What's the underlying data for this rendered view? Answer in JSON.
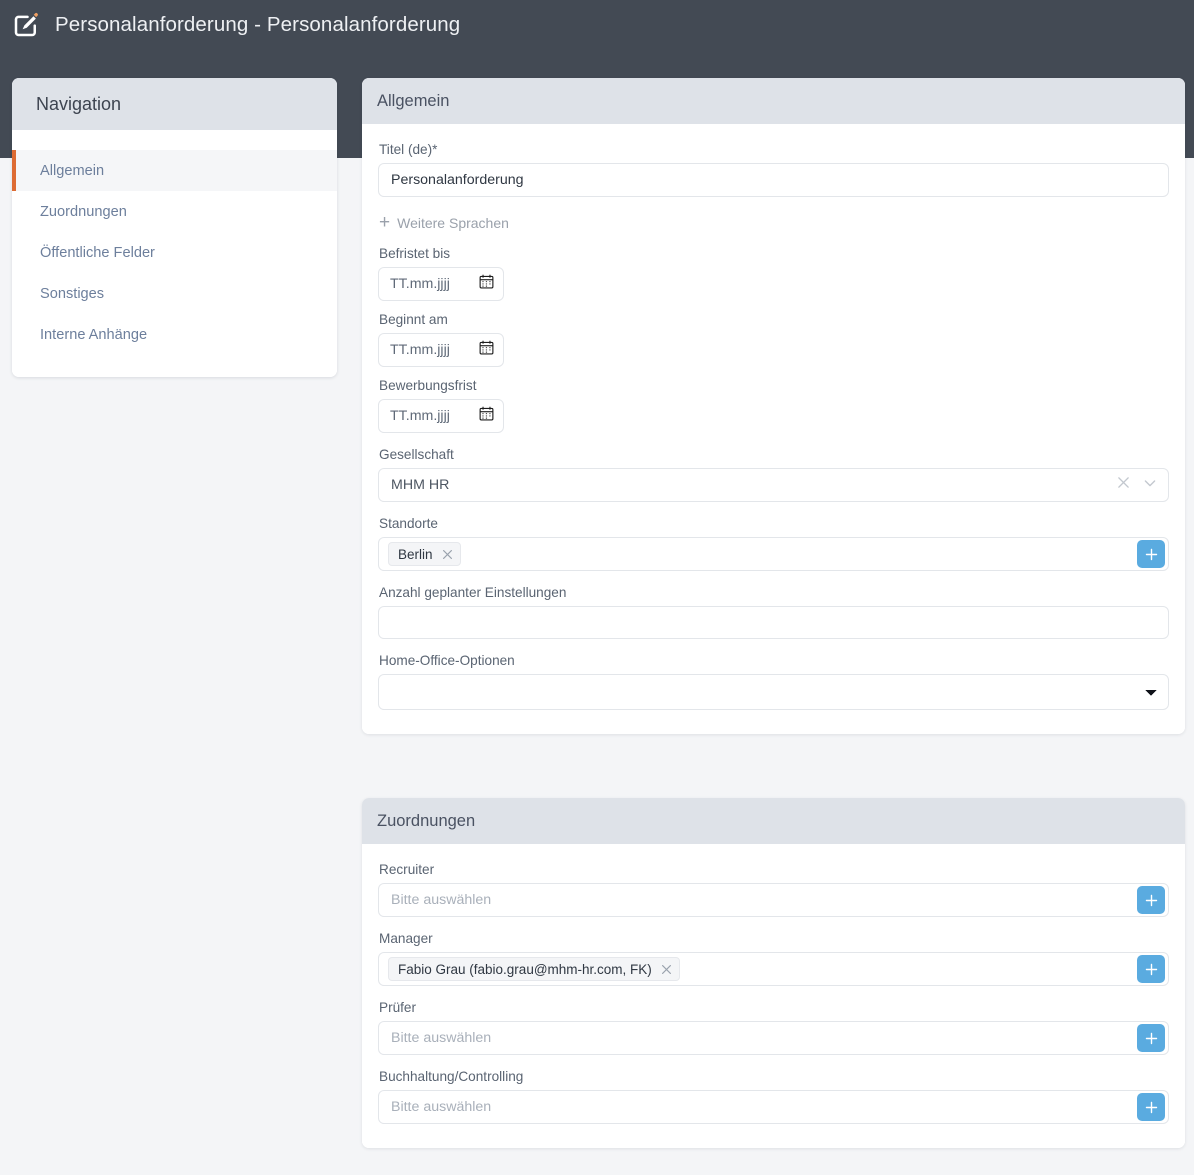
{
  "window": {
    "title": "Personalanforderung - Personalanforderung",
    "icon": "edit-pencil-square-icon"
  },
  "sidebar": {
    "heading": "Navigation",
    "items": [
      {
        "label": "Allgemein",
        "active": true
      },
      {
        "label": "Zuordnungen",
        "active": false
      },
      {
        "label": "Öffentliche Felder",
        "active": false
      },
      {
        "label": "Sonstiges",
        "active": false
      },
      {
        "label": "Interne Anhänge",
        "active": false
      }
    ]
  },
  "allgemein": {
    "heading": "Allgemein",
    "titel": {
      "label": "Titel (de)*",
      "value": "Personalanforderung"
    },
    "weitere_sprachen": {
      "label": "Weitere Sprachen",
      "icon": "plus-icon"
    },
    "befristet_bis": {
      "label": "Befristet bis",
      "placeholder": "TT.mm.jjjj",
      "icon": "calendar-icon"
    },
    "beginnt_am": {
      "label": "Beginnt am",
      "placeholder": "TT.mm.jjjj",
      "icon": "calendar-icon"
    },
    "bewerbungsfrist": {
      "label": "Bewerbungsfrist",
      "placeholder": "TT.mm.jjjj",
      "icon": "calendar-icon"
    },
    "gesellschaft": {
      "label": "Gesellschaft",
      "value": "MHM HR",
      "clear_icon": "close-icon",
      "chevron_icon": "chevron-down-icon"
    },
    "standorte": {
      "label": "Standorte",
      "tags": [
        "Berlin"
      ],
      "add_icon": "plus-icon"
    },
    "anzahl_einstellungen": {
      "label": "Anzahl geplanter Einstellungen",
      "value": ""
    },
    "home_office": {
      "label": "Home-Office-Optionen",
      "value": "",
      "options": [
        ""
      ]
    }
  },
  "zuordnungen": {
    "heading": "Zuordnungen",
    "recruiter": {
      "label": "Recruiter",
      "placeholder": "Bitte auswählen",
      "tags": [],
      "add_icon": "plus-icon"
    },
    "manager": {
      "label": "Manager",
      "placeholder": "Bitte auswählen",
      "tags": [
        "Fabio Grau (fabio.grau@mhm-hr.com, FK)"
      ],
      "add_icon": "plus-icon"
    },
    "pruefer": {
      "label": "Prüfer",
      "placeholder": "Bitte auswählen",
      "tags": [],
      "add_icon": "plus-icon"
    },
    "buchhaltung": {
      "label": "Buchhaltung/Controlling",
      "placeholder": "Bitte auswählen",
      "tags": [],
      "add_icon": "plus-icon"
    }
  },
  "colors": {
    "topbar": "#434a54",
    "card_header": "#dee2e8",
    "page_bg": "#f4f5f7",
    "accent_orange": "#dd6b33",
    "accent_blue": "#5aabe0",
    "link": "#6d7f9c"
  }
}
